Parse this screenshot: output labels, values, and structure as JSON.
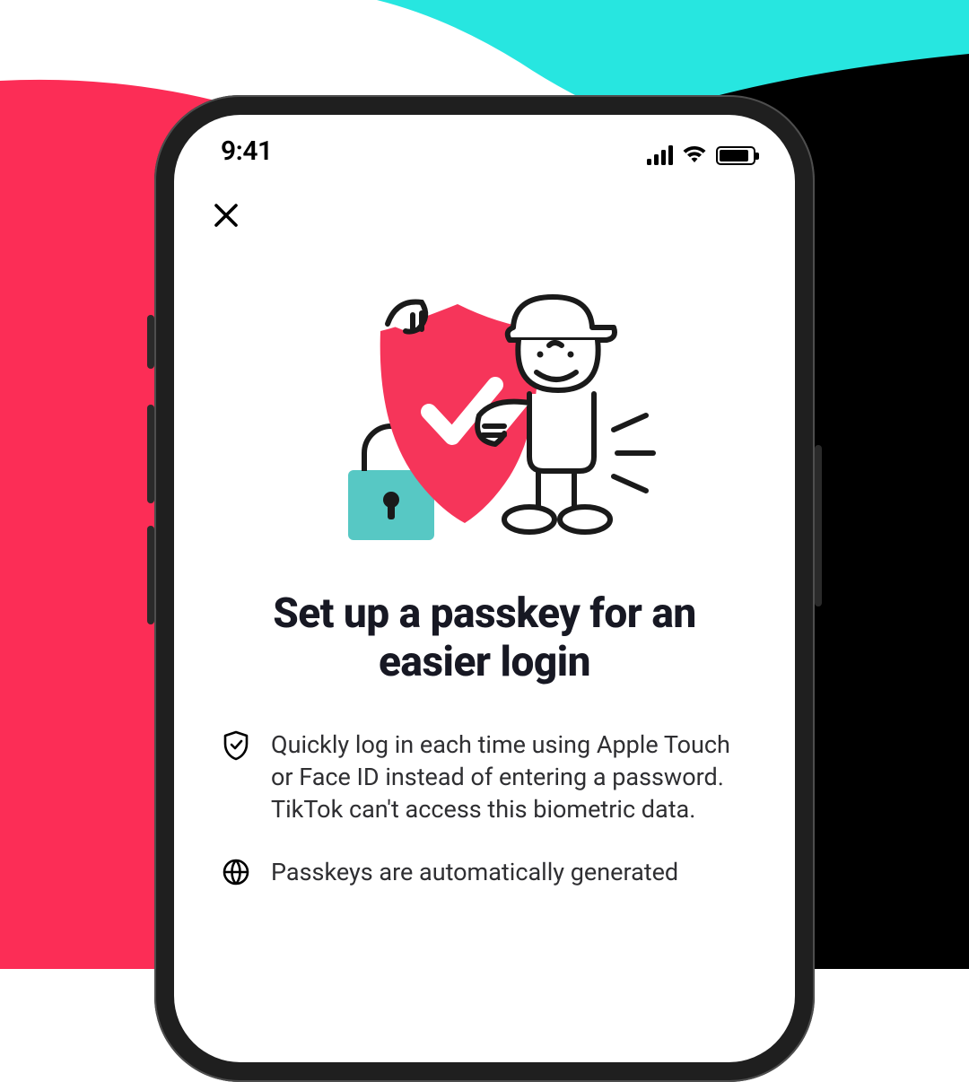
{
  "colors": {
    "pink": "#fc2d56",
    "cyan": "#27e6e0",
    "black": "#000000"
  },
  "status": {
    "time": "9:41"
  },
  "title": "Set up a passkey for an easier login",
  "bullets": [
    {
      "icon": "shield-check-icon",
      "text": "Quickly log in each time using Apple Touch or Face ID instead of entering a password. TikTok can't access this biometric data."
    },
    {
      "icon": "globe-icon",
      "text": "Passkeys are automatically generated"
    }
  ]
}
